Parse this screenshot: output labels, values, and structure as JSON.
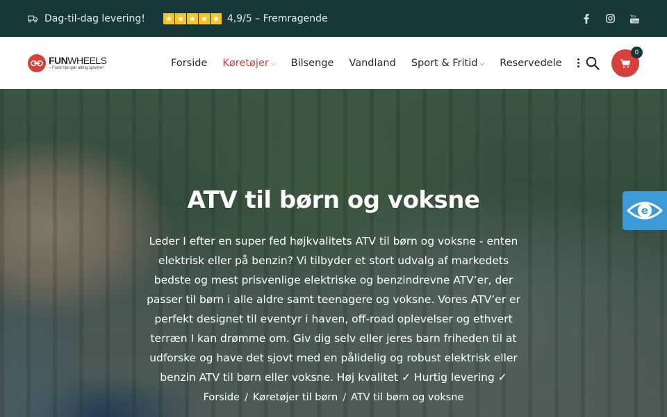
{
  "topbar": {
    "delivery_text": "Dag-til-dag levering!",
    "rating_text": "4,9/5 – Fremragende",
    "stars": 5,
    "social_icons": [
      "facebook-icon",
      "instagram-icon",
      "youtube-icon"
    ]
  },
  "header": {
    "logo": {
      "brand_bold": "FUN",
      "brand_rest": "WHEELS",
      "tagline": "– Fordi hjul gør alting sjovere!"
    },
    "nav": [
      {
        "label": "Forside",
        "active": false,
        "has_dropdown": false
      },
      {
        "label": "Køretøjer",
        "active": true,
        "has_dropdown": true
      },
      {
        "label": "Bilsenge",
        "active": false,
        "has_dropdown": false
      },
      {
        "label": "Vandland",
        "active": false,
        "has_dropdown": false
      },
      {
        "label": "Sport & Fritid",
        "active": false,
        "has_dropdown": true
      },
      {
        "label": "Reservedele",
        "active": false,
        "has_dropdown": false
      }
    ],
    "cart_count": "0"
  },
  "hero": {
    "title": "ATV til børn og voksne",
    "text": "Leder I efter en super fed højkvalitets ATV til børn og voksne - enten elektrisk eller på benzin? Vi tilbyder et stort udvalg af markedets bedste og mest prisvenlige elektriske og benzindrevne ATV’er, der passer til børn i alle aldre samt teenagere og voksne. Vores ATV’er er perfekt designet til eventyr i haven, off-road oplevelser og ethvert terræn I kan drømme om. Giv dig selv eller jeres barn friheden til at udforske og have det sjovt med en pålidelig og robust elektrisk eller benzin ATV til børn eller voksne. Høj kvalitet ✓ Hurtig levering ✓",
    "breadcrumb": [
      "Forside",
      "Køretøjer til børn",
      "ATV til børn og voksne"
    ],
    "breadcrumb_sep": "/"
  },
  "colors": {
    "topbar_bg": "#17373a",
    "accent": "#d8403a",
    "star": "#f6c51b",
    "a11y_tab": "#3d9ad9"
  }
}
